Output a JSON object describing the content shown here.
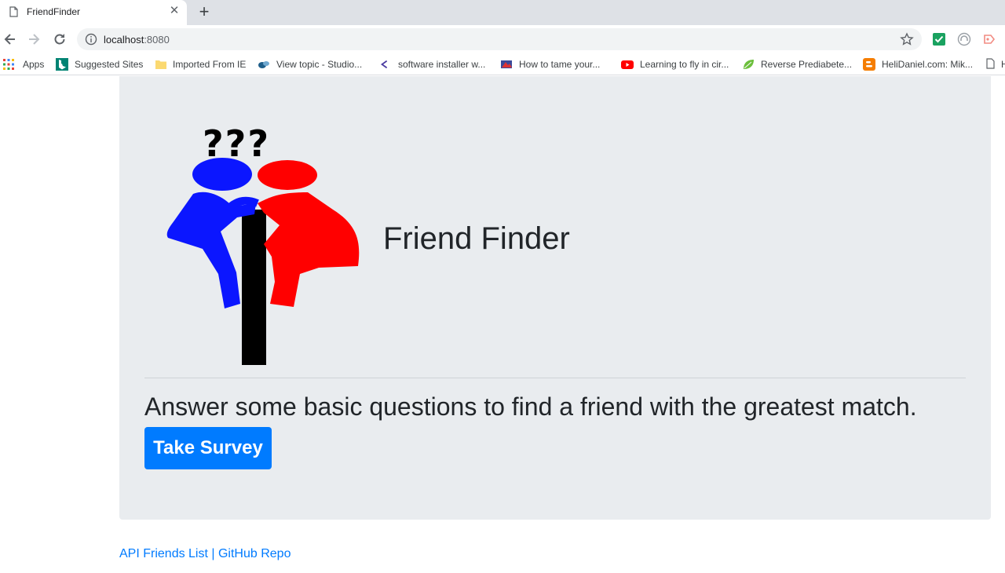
{
  "browser": {
    "tab": {
      "title": "FriendFinder",
      "close_glyph": "✕"
    },
    "new_tab_glyph": "+",
    "address": {
      "host": "localhost",
      "port": ":8080"
    },
    "bookmarks": [
      {
        "label": "Apps",
        "icon": "apps-grid-icon"
      },
      {
        "label": "Suggested Sites",
        "icon": "bing-icon"
      },
      {
        "label": "Imported From IE",
        "icon": "folder-icon"
      },
      {
        "label": "View topic - Studio...",
        "icon": "studio-icon"
      },
      {
        "label": "software installer w...",
        "icon": "angle-icon"
      },
      {
        "label": "How to tame your...",
        "icon": "site-icon"
      },
      {
        "label": "Learning to fly in cir...",
        "icon": "youtube-icon"
      },
      {
        "label": "Reverse Prediabete...",
        "icon": "leaf-icon"
      },
      {
        "label": "HeliDaniel.com: Mik...",
        "icon": "blogger-icon"
      },
      {
        "label": "H",
        "icon": "page-icon"
      }
    ]
  },
  "page": {
    "logo_text": "???",
    "title": "Friend Finder",
    "lead": "Answer some basic questions to find a friend with the greatest match.",
    "survey_button": "Take Survey",
    "footer": {
      "api_link": "API Friends List",
      "separator": " | ",
      "github_link": "GitHub Repo"
    }
  },
  "colors": {
    "primary": "#007bff",
    "jumbotron": "#e9ecef",
    "logo_blue": "#0b16ff",
    "logo_red": "#ff0000"
  }
}
